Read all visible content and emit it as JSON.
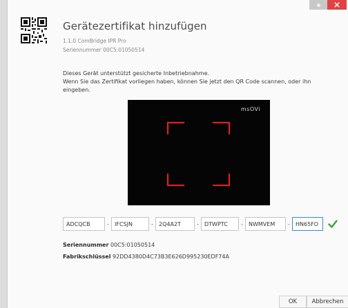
{
  "window": {
    "close_glyph": "×"
  },
  "header": {
    "title": "Gerätezertifikat hinzufügen",
    "device": "1.1.0 ComBridge IPR Pro",
    "serial_line": "Seriennummer 00C5:01050514"
  },
  "info": {
    "line1": "Dieses Gerät unterstützt gesicherte Inbetriebnahme.",
    "line2": "Wenn Sie das Zertifikat vorliegen haben, können Sie jetzt den QR Code scannen, oder ihn eingeben."
  },
  "scanner": {
    "brand": "msOVi",
    "frame_color": "#e02020"
  },
  "code": {
    "separator": "-",
    "fields": [
      "ADCQCB",
      "IFCSJN",
      "2Q4A2T",
      "DTWPTC",
      "NWMVEM",
      "HN65FO"
    ]
  },
  "details": {
    "serial_label": "Seriennummer",
    "serial_value": "00C5:01050514",
    "key_label": "Fabrikschlüssel",
    "key_value": "92DD4380D4C73B3E626D995230EDF74A"
  },
  "footer": {
    "ok": "OK",
    "cancel": "Abbrechen"
  },
  "colors": {
    "accent_check": "#3aa13a",
    "close_red": "#e04343"
  }
}
